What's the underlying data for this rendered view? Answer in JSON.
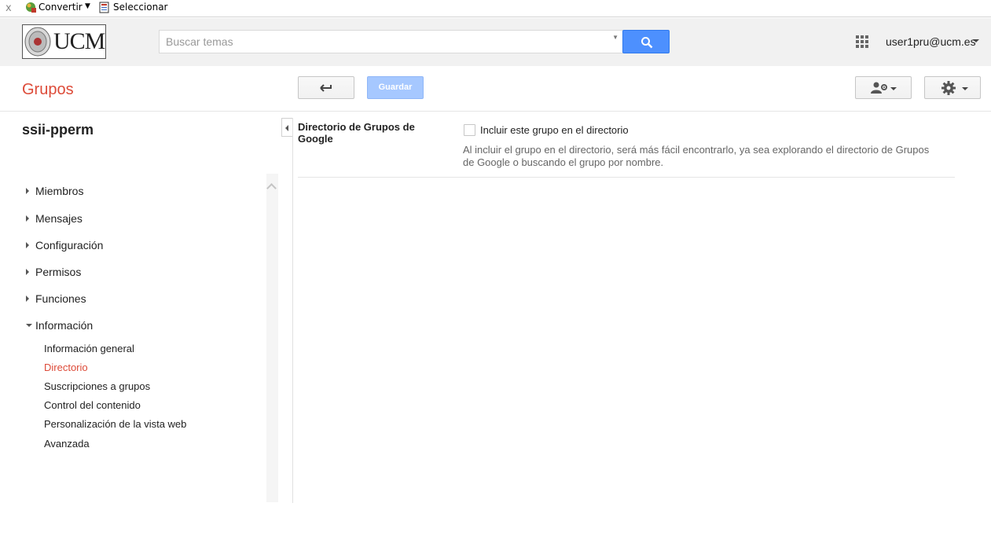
{
  "toolbar": {
    "close": "x",
    "convert_label": "Convertir",
    "select_label": "Seleccionar"
  },
  "header": {
    "logo_text": "UCM",
    "search_placeholder": "Buscar temas",
    "user_email": "user1pru@ucm.es"
  },
  "actionbar": {
    "app_title": "Grupos",
    "save_label": "Guardar"
  },
  "sidebar": {
    "group_name": "ssii-pperm",
    "items": [
      {
        "label": "Miembros"
      },
      {
        "label": "Mensajes"
      },
      {
        "label": "Configuración"
      },
      {
        "label": "Permisos"
      },
      {
        "label": "Funciones"
      },
      {
        "label": "Información"
      }
    ],
    "subitems": [
      {
        "label": "Información general"
      },
      {
        "label": "Directorio"
      },
      {
        "label": "Suscripciones a grupos"
      },
      {
        "label": "Control del contenido"
      },
      {
        "label": "Personalización de la vista web"
      },
      {
        "label": "Avanzada"
      }
    ]
  },
  "content": {
    "section_title": "Directorio de Grupos de Google",
    "checkbox_label": "Incluir este grupo en el directorio",
    "checkbox_checked": false,
    "description": "Al incluir el grupo en el directorio, será más fácil encontrarlo, ya sea explorando el directorio de Grupos de Google o buscando el grupo por nombre."
  },
  "colors": {
    "accent_red": "#dd4b39",
    "search_blue": "#4d90fe",
    "save_disabled_blue": "#a6c8ff"
  }
}
